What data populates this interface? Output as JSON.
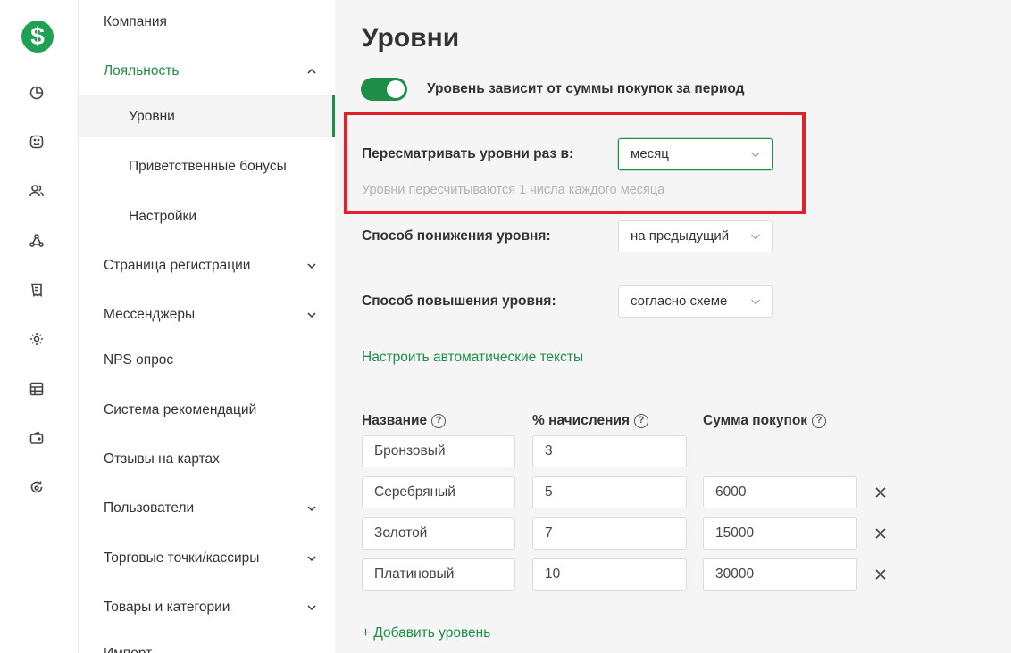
{
  "rail": {
    "logo": "$",
    "icons": [
      "dashboard-icon",
      "smile-icon",
      "users-icon",
      "network-icon",
      "receipt-icon",
      "settings-icon",
      "table-icon",
      "wallet-icon",
      "refresh-icon"
    ]
  },
  "menu": {
    "items": [
      {
        "label": "Компания"
      },
      {
        "label": "Лояльность"
      },
      {
        "label": "Уровни"
      },
      {
        "label": "Приветственные бонусы"
      },
      {
        "label": "Настройки"
      },
      {
        "label": "Страница регистрации"
      },
      {
        "label": "Мессенджеры"
      },
      {
        "label": "NPS опрос"
      },
      {
        "label": "Система рекомендаций"
      },
      {
        "label": "Отзывы на картах"
      },
      {
        "label": "Пользователи"
      },
      {
        "label": "Торговые точки/кассиры"
      },
      {
        "label": "Товары и категории"
      },
      {
        "label": "Импорт"
      }
    ]
  },
  "main": {
    "title": "Уровни",
    "toggle": {
      "label": "Уровень зависит от суммы покупок за период",
      "on": true
    },
    "review": {
      "label": "Пересматривать уровни раз в:",
      "value": "месяц",
      "hint": "Уровни пересчитываются 1 числа каждого месяца"
    },
    "downgrade": {
      "label": "Способ понижения уровня:",
      "value": "на предыдущий"
    },
    "upgrade": {
      "label": "Способ повышения уровня:",
      "value": "согласно схеме"
    },
    "auto_texts_link": "Настроить автоматические тексты",
    "table": {
      "headers": [
        "Название",
        "% начисления",
        "Сумма покупок"
      ],
      "help_glyph": "?",
      "rows": [
        {
          "name": "Бронзовый",
          "percent": "3",
          "sum": ""
        },
        {
          "name": "Серебряный",
          "percent": "5",
          "sum": "6000"
        },
        {
          "name": "Золотой",
          "percent": "7",
          "sum": "15000"
        },
        {
          "name": "Платиновый",
          "percent": "10",
          "sum": "30000"
        }
      ]
    },
    "add_level_link": "+ Добавить уровень"
  },
  "colors": {
    "accent": "#1e8e46",
    "highlight": "#e0202a",
    "logo": "#1ea152"
  }
}
